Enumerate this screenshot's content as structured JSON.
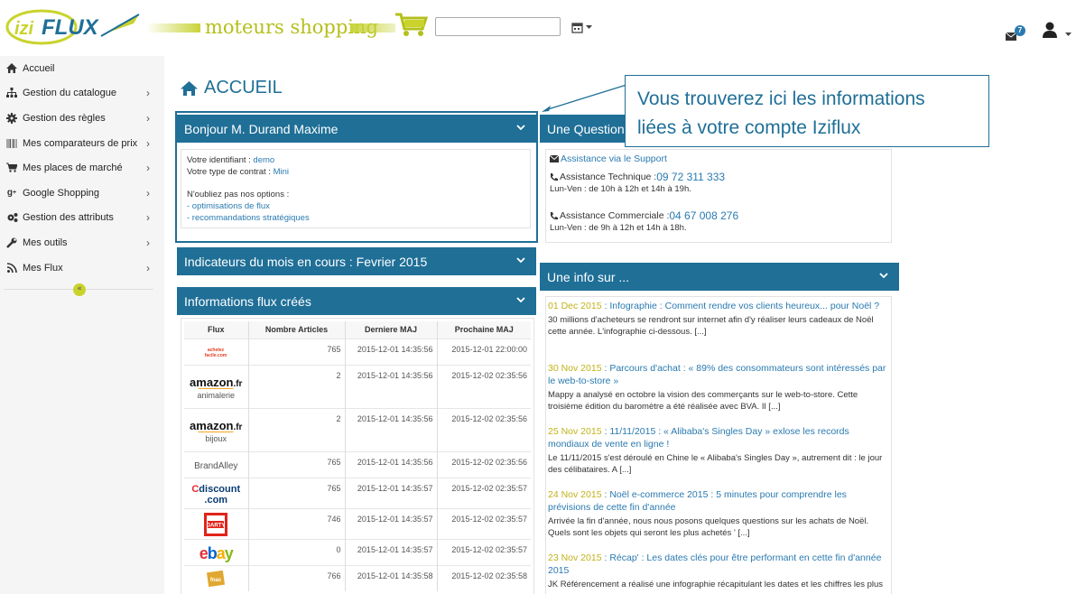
{
  "header": {
    "logo_text": "iziFLUX",
    "tagline": "moteurs shopping",
    "search_value": "",
    "mail_count": "7"
  },
  "sidebar": {
    "items": [
      {
        "label": "Accueil",
        "icon": "home-icon"
      },
      {
        "label": "Gestion du catalogue",
        "icon": "sitemap-icon"
      },
      {
        "label": "Gestion des règles",
        "icon": "gear-icon"
      },
      {
        "label": "Mes comparateurs de prix",
        "icon": "barcode-icon"
      },
      {
        "label": "Mes places de marché",
        "icon": "cart-icon"
      },
      {
        "label": "Google Shopping",
        "icon": "google-plus-icon"
      },
      {
        "label": "Gestion des attributs",
        "icon": "gears-icon"
      },
      {
        "label": "Mes outils",
        "icon": "wrench-icon"
      },
      {
        "label": "Mes Flux",
        "icon": "rss-icon"
      }
    ],
    "collapse_glyph": "«"
  },
  "main": {
    "title": "ACCUEIL",
    "welcome": {
      "heading": "Bonjour M. Durand Maxime",
      "id_label": "Votre identifiant : ",
      "id_value": "demo",
      "contract_label": "Votre type de contrat : ",
      "contract_value": "Mini",
      "options_label": "N'oubliez pas nos options :",
      "option1": "- optimisations de flux",
      "option2": "- recommandations stratégiques"
    },
    "indicators": {
      "heading": "Indicateurs du mois en cours : Fevrier 2015"
    },
    "flux_info": {
      "heading": "Informations flux créés",
      "columns": [
        "Flux",
        "Nombre Articles",
        "Derniere MAJ",
        "Prochaine MAJ"
      ],
      "rows": [
        {
          "logo": "achetez-facile",
          "sub": "",
          "count": "765",
          "last": "2015-12-01 14:35:56",
          "next": "2015-12-01 22:00:00"
        },
        {
          "logo": "amazon.fr",
          "sub": "animalerie",
          "count": "2",
          "last": "2015-12-01 14:35:56",
          "next": "2015-12-02 02:35:56"
        },
        {
          "logo": "amazon.fr",
          "sub": "bijoux",
          "count": "2",
          "last": "2015-12-01 14:35:56",
          "next": "2015-12-02 02:35:56"
        },
        {
          "logo": "BrandAlley",
          "sub": "",
          "count": "765",
          "last": "2015-12-01 14:35:56",
          "next": "2015-12-02 02:35:56"
        },
        {
          "logo": "Cdiscount.com",
          "sub": "",
          "count": "765",
          "last": "2015-12-01 14:35:57",
          "next": "2015-12-02 02:35:57"
        },
        {
          "logo": "DARTY",
          "sub": "",
          "count": "746",
          "last": "2015-12-01 14:35:57",
          "next": "2015-12-02 02:35:57"
        },
        {
          "logo": "ebay",
          "sub": "",
          "count": "0",
          "last": "2015-12-01 14:35:57",
          "next": "2015-12-02 02:35:57"
        },
        {
          "logo": "fnac",
          "sub": "",
          "count": "766",
          "last": "2015-12-01 14:35:58",
          "next": "2015-12-02 02:35:58"
        }
      ]
    },
    "question": {
      "heading": "Une Question",
      "support_link": "Assistance via le Support",
      "tech_label": "Assistance Technique : ",
      "tech_phone": "09 72 311 333",
      "tech_hours": "Lun-Ven : de 10h à 12h et 14h à 19h.",
      "com_label": "Assistance Commerciale : ",
      "com_phone": "04 67 008 276",
      "com_hours": "Lun-Ven : de 9h à 12h et 14h à 18h."
    },
    "info": {
      "heading": "Une info sur ...",
      "news": [
        {
          "date": "01 Dec 2015",
          "title": "Infographie : Comment rendre vos clients heureux... pour Noël ?",
          "text": "30 millions d'acheteurs se rendront sur internet afin d'y réaliser leurs cadeaux de Noël cette année. L'infographie ci-dessous. [...]"
        },
        {
          "date": "30 Nov 2015",
          "title": "Parcours d'achat : « 89% des consommateurs sont intéressés par le web-to-store »",
          "text": "Mappy a analysé en octobre la vision des commerçants sur le web-to-store. Cette troisième édition du baromètre a été réalisée avec BVA. Il [...]"
        },
        {
          "date": "25 Nov 2015",
          "title": "11/11/2015 : « Alibaba's Singles Day » exlose les records mondiaux de vente en ligne !",
          "text": "Le 11/11/2015 s'est déroulé en Chine le « Alibaba's Singles Day », autrement dit : le jour des célibataires. A [...]"
        },
        {
          "date": "24 Nov 2015",
          "title": "Noël e-commerce 2015 : 5 minutes pour comprendre les prévisions de cette fin d'année",
          "text": "Arrivée la fin d'année, nous nous posons quelques questions sur les achats de Noël. Quels sont les objets qui seront les plus achetés ' [...]"
        },
        {
          "date": "23 Nov 2015",
          "title": "Récap' : Les dates clés pour être performant en cette fin d'année 2015",
          "text": "JK Référencement a réalisé une infographie récapitulant les dates et les chiffres les plus"
        }
      ]
    }
  },
  "callout": {
    "line1": "Vous trouverez ici les informations",
    "line2": "liées à votre compte Iziflux"
  },
  "colors": {
    "primary": "#1f6f97",
    "accent": "#c9d32c",
    "link": "#2a7ab0"
  }
}
